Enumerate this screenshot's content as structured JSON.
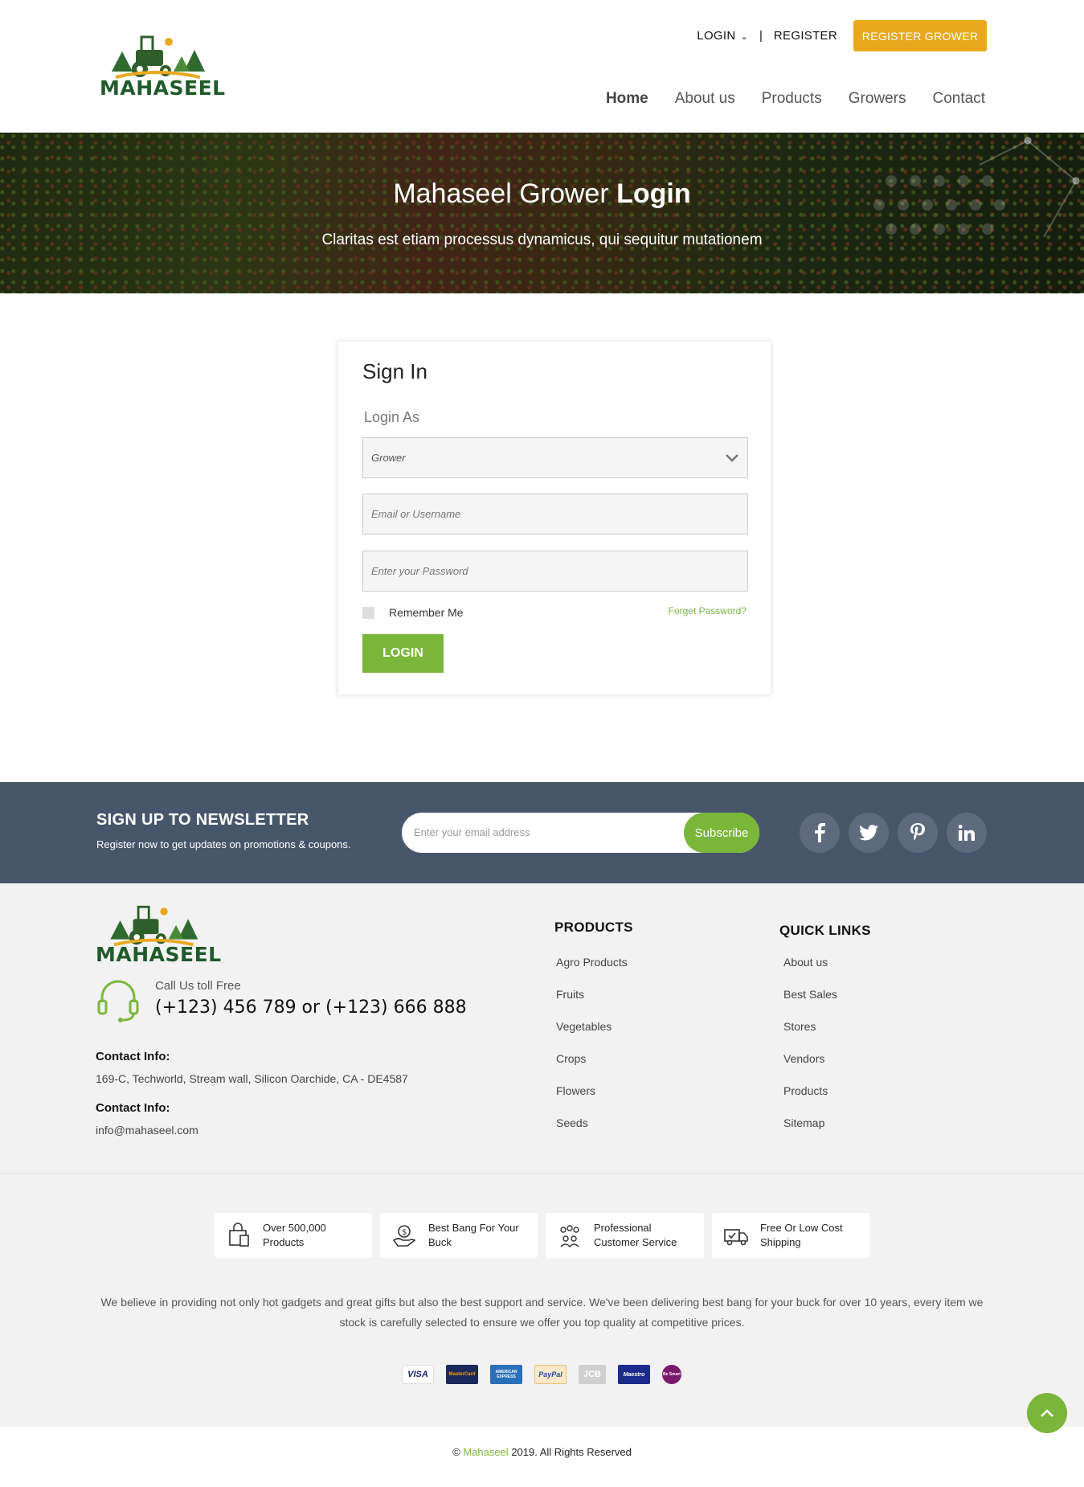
{
  "brand": {
    "name": "MAHASEEL"
  },
  "header": {
    "login": "LOGIN",
    "separator": "|",
    "register": "REGISTER",
    "register_grower": "REGISTER GROWER",
    "nav": [
      "Home",
      "About us",
      "Products",
      "Growers",
      "Contact"
    ],
    "active_nav": "Home"
  },
  "hero": {
    "title_normal": "Mahaseel Grower",
    "title_bold": "Login",
    "subtitle": "Claritas est etiam processus dynamicus, qui sequitur mutationem"
  },
  "signin": {
    "title": "Sign In",
    "login_as_label": "Login As",
    "login_as_value": "Grower",
    "email_placeholder": "Email or Username",
    "password_placeholder": "Enter your Password",
    "remember_me": "Remember Me",
    "forget_password": "Forget Password?",
    "login_button": "LOGIN"
  },
  "newsletter": {
    "title": "SIGN UP TO NEWSLETTER",
    "subtitle": "Register now to get updates on promotions & coupons.",
    "email_placeholder": "Enter your email address",
    "subscribe": "Subscribe",
    "socials": [
      "facebook-icon",
      "twitter-icon",
      "pinterest-icon",
      "linkedin-icon"
    ]
  },
  "footer": {
    "call_label": "Call Us toll Free",
    "call_number": "(+123) 456 789 or (+123) 666 888",
    "contact_label_1": "Contact Info:",
    "contact_address": "169-C, Techworld, Stream wall, Silicon Oarchide, CA - DE4587",
    "contact_label_2": "Contact Info:",
    "contact_email": "info@mahaseel.com",
    "products_title": "PRODUCTS",
    "products": [
      "Agro Products",
      "Fruits",
      "Vegetables",
      "Crops",
      "Flowers",
      "Seeds"
    ],
    "quick_title": "QUICK LINKS",
    "quick_links": [
      "About us",
      "Best Sales",
      "Stores",
      "Vendors",
      "Products",
      "Sitemap"
    ]
  },
  "features": [
    {
      "line1": "Over 500,000",
      "line2": "Products",
      "icon": "shopping-bag-icon"
    },
    {
      "line1": "Best Bang For Your",
      "line2": "Buck",
      "icon": "money-hand-icon"
    },
    {
      "line1": "Professional",
      "line2": "Customer Service",
      "icon": "team-icon"
    },
    {
      "line1": "Free Or Low Cost",
      "line2": "Shipping",
      "icon": "truck-icon"
    }
  ],
  "about_text": "We believe in providing not only hot gadgets and great gifts but also the best support and service. We've been delivering best bang for your buck for over 10 years, every item we stock is carefully selected to ensure we offer you top quality at competitive prices.",
  "payments": [
    "VISA",
    "MasterCard",
    "AMERICAN EXPRESS",
    "PayPal",
    "JCB",
    "Maestro",
    "Be Smart"
  ],
  "copyright": {
    "prefix": "©",
    "brand": "Mahaseel",
    "suffix": "2019. All Rights Reserved"
  },
  "colors": {
    "green": "#7ab63a",
    "orange": "#e9a81d",
    "navy": "#48566b"
  }
}
